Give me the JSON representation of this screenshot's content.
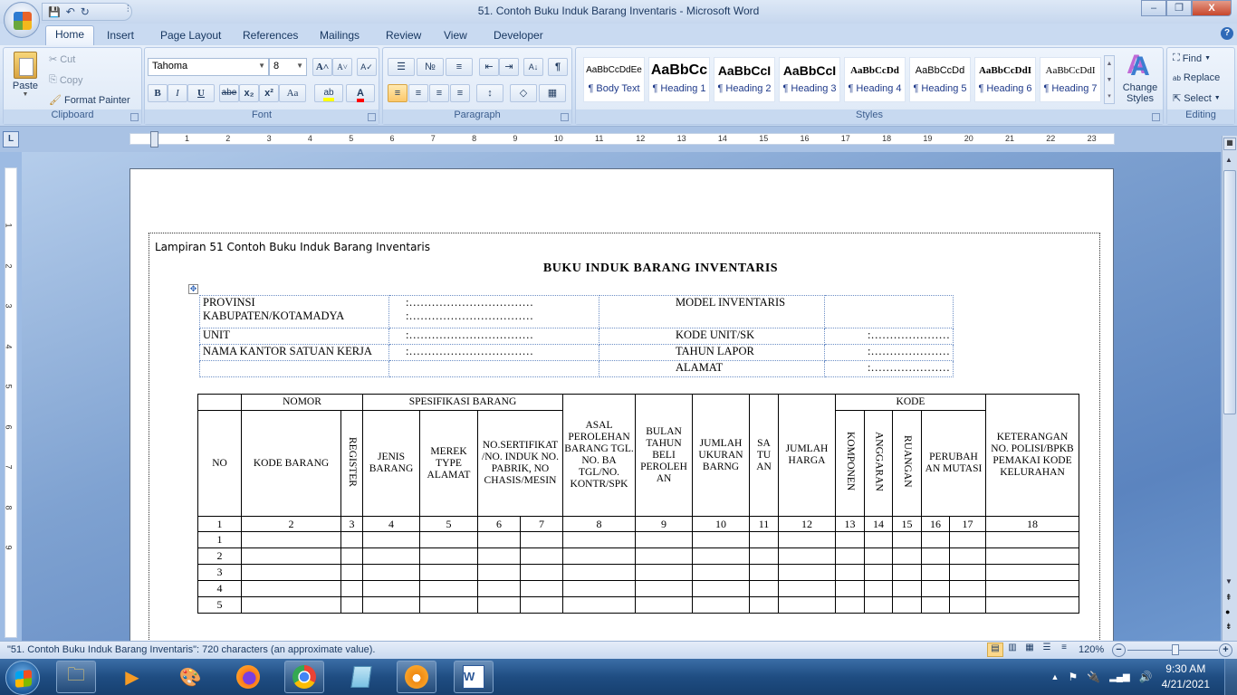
{
  "window": {
    "title": "51. Contoh Buku Induk Barang Inventaris - Microsoft Word",
    "controls": {
      "minimize": "–",
      "restore": "❐",
      "close": "X"
    }
  },
  "quick_access": {
    "save": "💾",
    "undo": "↶",
    "redo": "↻",
    "customize": "⫶"
  },
  "tabs": [
    "Home",
    "Insert",
    "Page Layout",
    "References",
    "Mailings",
    "Review",
    "View",
    "Developer"
  ],
  "active_tab": "Home",
  "ribbon": {
    "clipboard": {
      "paste": "Paste",
      "cut": "Cut",
      "copy": "Copy",
      "format_painter": "Format Painter",
      "label": "Clipboard"
    },
    "font": {
      "name": "Tahoma",
      "size": "8",
      "label": "Font",
      "buttons": [
        "B",
        "I",
        "U",
        "abe",
        "x₂",
        "x²",
        "Aa"
      ],
      "grow": "A˄",
      "shrink": "A˅",
      "clear": "A✓",
      "highlight": "ab",
      "color": "A",
      "highlight_color": "#ffff00",
      "font_color": "#ff0000"
    },
    "paragraph": {
      "label": "Paragraph",
      "bullets": "☰",
      "numbering": "№",
      "multilevel": "≡",
      "decrease_indent": "⇤",
      "increase_indent": "⇥",
      "sort": "A↓",
      "pilcrow": "¶",
      "align_left": "≡",
      "center": "≡",
      "align_right": "≡",
      "justify": "≡",
      "line_spacing": "↕",
      "shading": "◇",
      "borders": "▦"
    },
    "styles": {
      "label": "Styles",
      "items": [
        {
          "preview": "AaBbCcDdEe",
          "name": "¶ Body Text"
        },
        {
          "preview": "AaBbCc",
          "name": "¶ Heading 1"
        },
        {
          "preview": "AaBbCcI",
          "name": "¶ Heading 2"
        },
        {
          "preview": "AaBbCcI",
          "name": "¶ Heading 3"
        },
        {
          "preview": "AaBbCcDd",
          "name": "¶ Heading 4"
        },
        {
          "preview": "AaBbCcDd",
          "name": "¶ Heading 5"
        },
        {
          "preview": "AaBbCcDdI",
          "name": "¶ Heading 6"
        },
        {
          "preview": "AaBbCcDdI",
          "name": "¶ Heading 7"
        }
      ],
      "change_styles": "Change Styles"
    },
    "editing": {
      "label": "Editing",
      "find": "Find",
      "replace": "Replace",
      "select": "Select"
    }
  },
  "ruler": {
    "h_marks": [
      "1",
      "2",
      "3",
      "4",
      "5",
      "6",
      "7",
      "8",
      "9",
      "10",
      "11",
      "12",
      "13",
      "14",
      "15",
      "16",
      "17",
      "18",
      "19",
      "20",
      "21",
      "22",
      "23"
    ],
    "v_marks": [
      "1",
      "2",
      "3",
      "4",
      "5",
      "6",
      "7",
      "8",
      "9"
    ]
  },
  "document": {
    "lampiran": "Lampiran 51  Contoh  Buku  Induk  Barang  Inventaris",
    "title": "BUKU  INDUK  BARANG  INVENTARIS",
    "info": [
      [
        "PROVINSI",
        ":……………………………",
        "MODEL INVENTARIS",
        ""
      ],
      [
        "KABUPATEN/KOTAMADYA",
        ":……………………………",
        "",
        ""
      ],
      [
        "UNIT",
        ":……………………………",
        "KODE UNIT/SK",
        ":…………………"
      ],
      [
        "NAMA KANTOR  SATUAN KERJA",
        ":……………………………",
        "TAHUN LAPOR",
        ":…………………"
      ],
      [
        "",
        "",
        "ALAMAT",
        ":…………………"
      ]
    ],
    "table": {
      "group_headers": {
        "nomor": "NOMOR",
        "spesifikasi": "SPESIFIKASI BARANG",
        "kode": "KODE"
      },
      "headers": {
        "no": "NO",
        "kode_barang": "KODE BARANG",
        "register": "REGISTER",
        "jenis": "JENIS BARANG",
        "merek": "MEREK TYPE ALAMAT",
        "sertifikat": "NO.SERTIFIKAT /NO. INDUK NO. PABRIK, NO CHASIS/MESIN",
        "asal": "ASAL PEROLEHAN BARANG TGL. NO. BA TGL/NO. KONTR/SPK",
        "bulan": "BULAN TAHUN BELI PEROLEH AN",
        "jumlah_ukuran": "JUMLAH UKURAN BARNG",
        "satuan": "SA TU AN",
        "jumlah_harga": "JUMLAH HARGA",
        "komponen": "KOMPONEN",
        "anggaran": "ANGGARAN",
        "ruangan": "RUANGAN",
        "perubahan": "PERUBAH AN MUTASI",
        "keterangan": "KETERANGAN NO. POLISI/BPKB PEMAKAI KODE KELURAHAN"
      },
      "column_numbers": [
        "1",
        "2",
        "3",
        "4",
        "5",
        "6",
        "7",
        "8",
        "9",
        "10",
        "11",
        "12",
        "13",
        "14",
        "15",
        "16",
        "17",
        "18"
      ],
      "rows": [
        "1",
        "2",
        "3",
        "4",
        "5"
      ]
    }
  },
  "status": {
    "text": "\"51. Contoh Buku Induk Barang Inventaris\": 720 characters (an approximate value).",
    "zoom": "120%",
    "zoom_level_percent": 120
  },
  "taskbar": {
    "apps": [
      "Windows Explorer",
      "Windows Media Player",
      "Paint",
      "Firefox",
      "Chrome",
      "Notepad",
      "GOM Player",
      "Microsoft Word"
    ],
    "time": "9:30 AM",
    "date": "4/21/2021"
  }
}
